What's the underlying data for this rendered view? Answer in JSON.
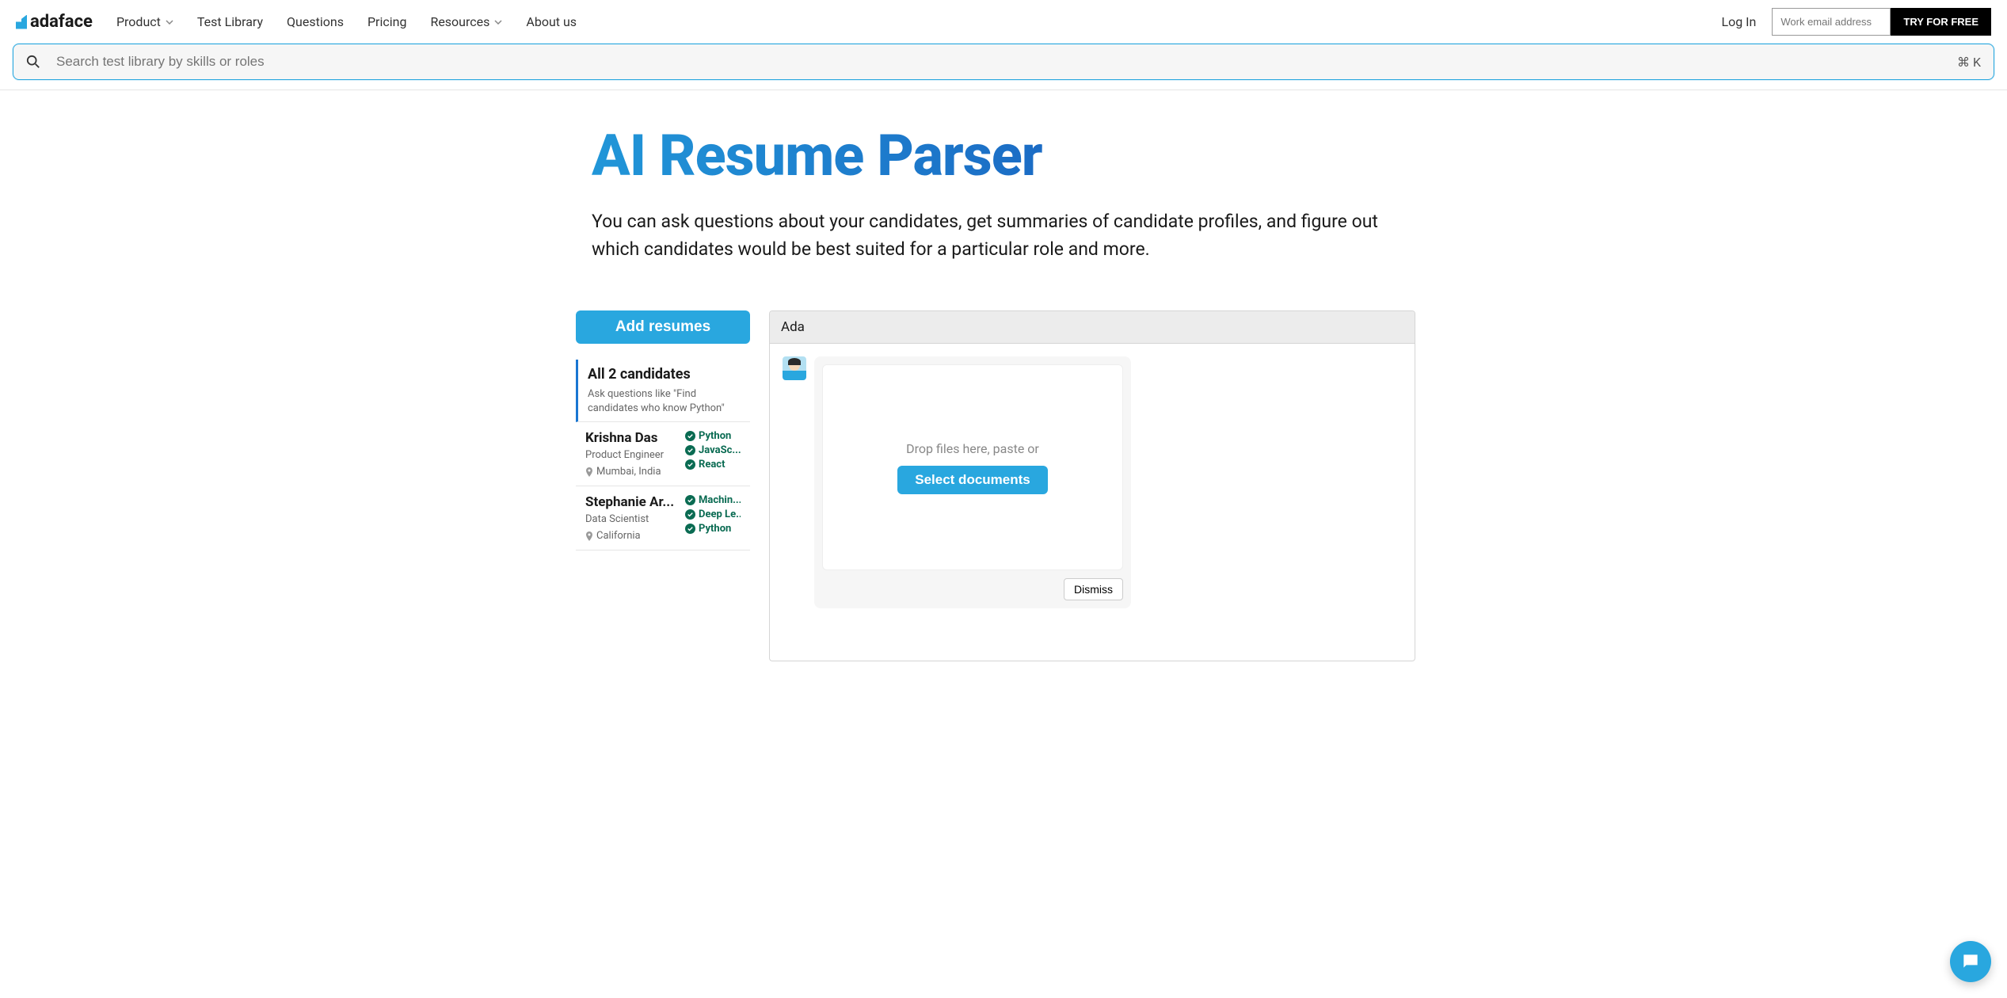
{
  "header": {
    "logo": "adaface",
    "nav": {
      "product": "Product",
      "test_library": "Test Library",
      "questions": "Questions",
      "pricing": "Pricing",
      "resources": "Resources",
      "about": "About us"
    },
    "login": "Log In",
    "email_placeholder": "Work email address",
    "try_free": "TRY FOR FREE"
  },
  "search": {
    "placeholder": "Search test library by skills or roles",
    "shortcut": "⌘ K"
  },
  "page": {
    "title": "AI Resume Parser",
    "subtitle": "You can ask questions about your candidates, get summaries of candidate profiles, and figure out which candidates would be best suited for a particular role and more."
  },
  "sidebar": {
    "add": "Add resumes",
    "all_title": "All 2 candidates",
    "all_hint": "Ask questions like \"Find candidates who know Python\"",
    "candidates": [
      {
        "name": "Krishna Das",
        "role": "Product Engineer",
        "location": "Mumbai, India",
        "skills": [
          "Python",
          "JavaSc...",
          "React"
        ]
      },
      {
        "name": "Stephanie Ar...",
        "role": "Data Scientist",
        "location": "California",
        "skills": [
          "Machin...",
          "Deep Le...",
          "Python"
        ]
      }
    ]
  },
  "chat": {
    "header": "Ada",
    "drop_text": "Drop files here, paste or",
    "select": "Select documents",
    "dismiss": "Dismiss"
  }
}
